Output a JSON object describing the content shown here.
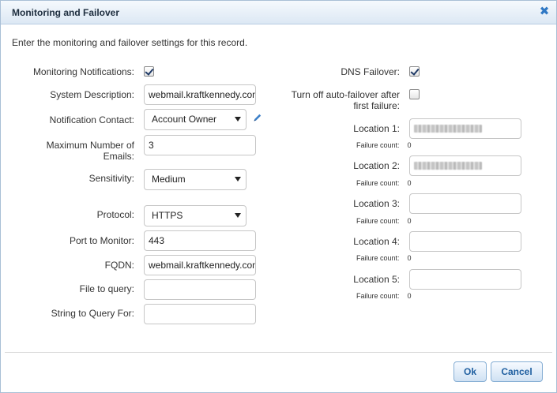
{
  "dialog": {
    "title": "Monitoring and Failover",
    "close_icon": "close-icon"
  },
  "instructions": "Enter the monitoring and failover settings for this record.",
  "left": {
    "monitoring_notifications": {
      "label": "Monitoring Notifications:",
      "checked": true
    },
    "system_description": {
      "label": "System Description:",
      "value": "webmail.kraftkennedy.com"
    },
    "notification_contact": {
      "label": "Notification Contact:",
      "value": "Account Owner",
      "edit_icon": "pencil-icon"
    },
    "max_emails": {
      "label_line1": "Maximum Number of",
      "label_line2": "Emails:",
      "value": "3"
    },
    "sensitivity": {
      "label": "Sensitivity:",
      "value": "Medium"
    },
    "protocol": {
      "label": "Protocol:",
      "value": "HTTPS"
    },
    "port": {
      "label": "Port to Monitor:",
      "value": "443"
    },
    "fqdn": {
      "label": "FQDN:",
      "value": "webmail.kraftkennedy.com"
    },
    "file_to_query": {
      "label": "File to query:",
      "value": ""
    },
    "string_to_query": {
      "label": "String to Query For:",
      "value": ""
    }
  },
  "right": {
    "dns_failover": {
      "label": "DNS Failover:",
      "checked": true
    },
    "auto_failover": {
      "label_line1": "Turn off auto-failover after",
      "label_line2": "first failure:",
      "checked": false
    },
    "failure_count_label": "Failure count:",
    "locations": [
      {
        "label": "Location 1:",
        "value_redacted": true,
        "failure_count": "0"
      },
      {
        "label": "Location 2:",
        "value_redacted": true,
        "failure_count": "0"
      },
      {
        "label": "Location 3:",
        "value_redacted": false,
        "failure_count": "0"
      },
      {
        "label": "Location 4:",
        "value_redacted": false,
        "failure_count": "0"
      },
      {
        "label": "Location 5:",
        "value_redacted": false,
        "failure_count": "0"
      }
    ]
  },
  "buttons": {
    "ok": "Ok",
    "cancel": "Cancel"
  },
  "colors": {
    "accent": "#2f78c4",
    "button_text": "#1f5fa0"
  }
}
